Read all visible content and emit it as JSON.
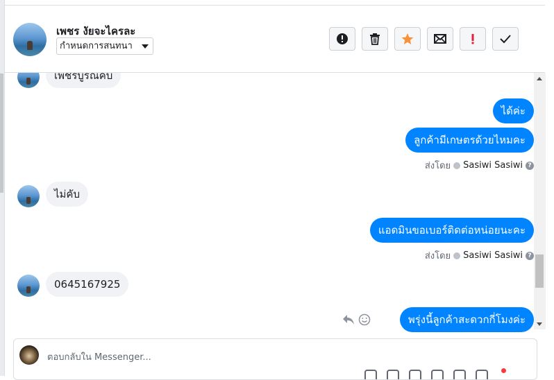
{
  "header": {
    "contact_name": "เพชร งัยจะไครละ",
    "conversation_status": "กำหนดการสนทนา",
    "actions": [
      {
        "name": "mark-spam-button",
        "icon": "exclamation-circle-icon"
      },
      {
        "name": "delete-button",
        "icon": "trash-icon"
      },
      {
        "name": "star-button",
        "icon": "star-icon",
        "color": "#f7923a"
      },
      {
        "name": "mark-unread-button",
        "icon": "envelope-icon"
      },
      {
        "name": "follow-up-button",
        "icon": "exclamation-icon",
        "color": "#e41e3f"
      },
      {
        "name": "mark-done-button",
        "icon": "checkmark-icon"
      }
    ]
  },
  "conversation": {
    "incoming_color": "#f0f2f5",
    "outgoing_color": "#0084ff",
    "messages": {
      "in_1": "เพชรบูรณคับ",
      "out_1": "ได้ค่ะ",
      "out_2": "ลูกค้ามีเกษตรด้วยไหมคะ",
      "in_2": "ไม่คับ",
      "out_3": "แอดมินขอเบอร์ติดต่อหน่อยนะคะ",
      "in_3": "0645167925",
      "out_4": "พรุ่งนี้ลูกค้าสะดวกกี่โมงค่ะ"
    },
    "sent_by_label": "ส่งโดย",
    "sent_by_name": "Sasiwi Sasiwi"
  },
  "composer": {
    "placeholder": "ตอบกลับใน Messenger..."
  }
}
